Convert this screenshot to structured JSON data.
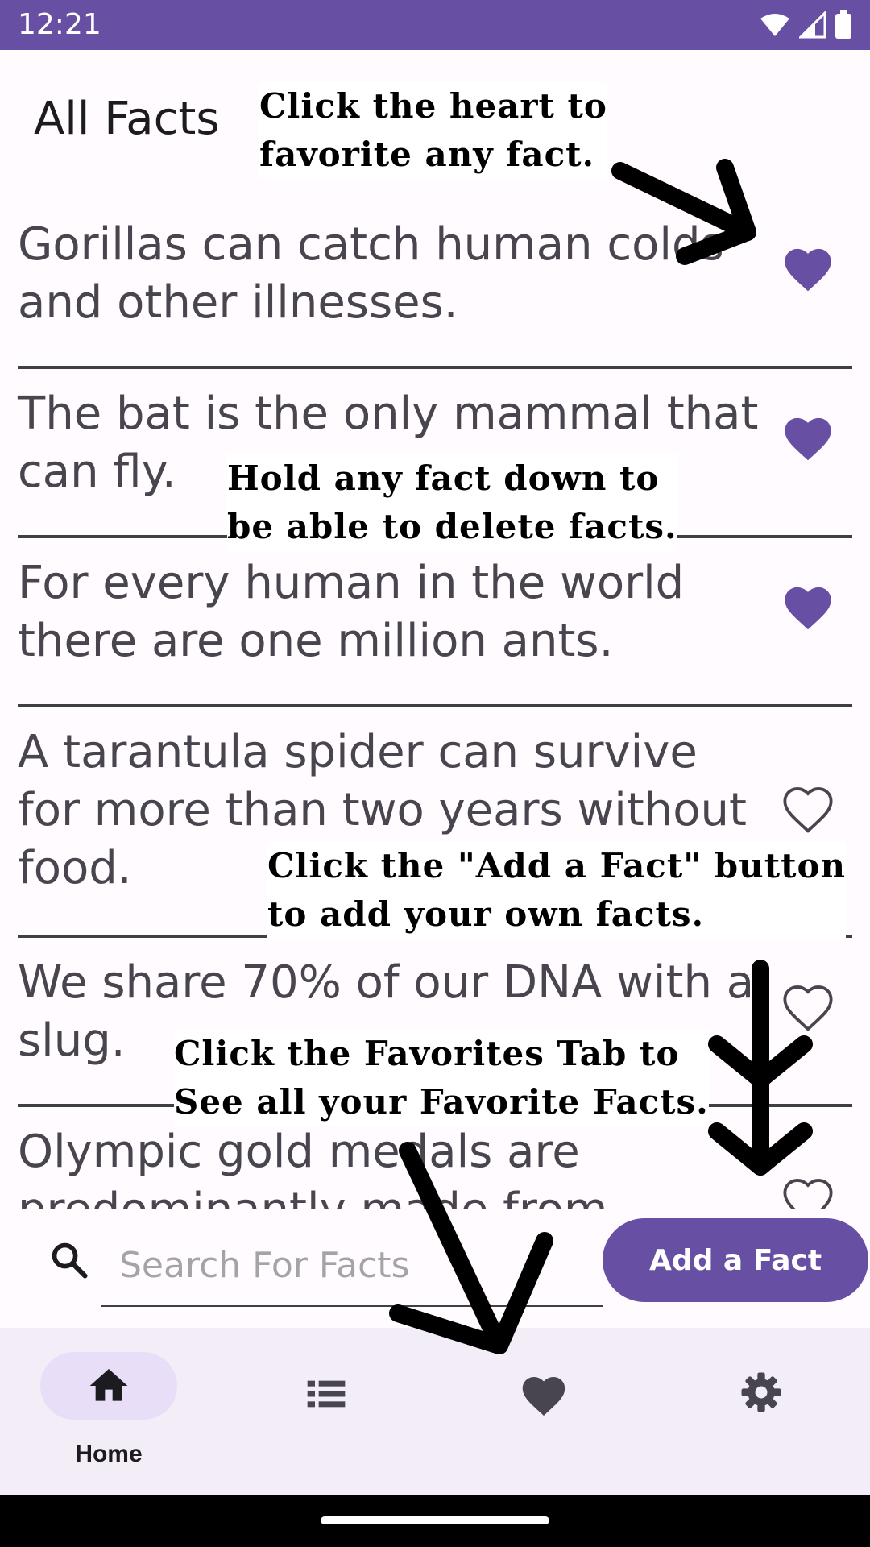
{
  "status_bar": {
    "time": "12:21"
  },
  "page": {
    "title": "All Facts"
  },
  "facts": [
    {
      "text": "Gorillas can catch human colds and other illnesses.",
      "favorited": true
    },
    {
      "text": "The bat is the only mammal that can fly.",
      "favorited": true
    },
    {
      "text": "For every human in the world there are one million ants.",
      "favorited": true
    },
    {
      "text": "A tarantula spider can survive for more than two years without food.",
      "favorited": false
    },
    {
      "text": "We share 70% of our DNA with a slug.",
      "favorited": false
    },
    {
      "text": "Olympic gold medals are predominantly made from",
      "favorited": false
    }
  ],
  "tutorial": {
    "heart_tip": "Click the heart to\nfavorite any fact.",
    "delete_tip": "Hold any fact down to\nbe able to delete facts.",
    "add_tip": "Click the \"Add a Fact\" button\nto add your own facts.",
    "favorites_tip": "Click the Favorites Tab to\nSee all your Favorite Facts."
  },
  "search": {
    "placeholder": "Search For Facts",
    "value": ""
  },
  "add_button": {
    "label": "Add a Fact"
  },
  "nav": {
    "items": [
      {
        "icon": "home-icon",
        "label": "Home",
        "selected": true
      },
      {
        "icon": "list-icon",
        "label": "",
        "selected": false
      },
      {
        "icon": "heart-icon",
        "label": "",
        "selected": false
      },
      {
        "icon": "gear-icon",
        "label": "",
        "selected": false
      }
    ]
  },
  "colors": {
    "primary": "#6750a4",
    "nav_background": "#f3edf7",
    "nav_pill": "#e8def8",
    "background": "#fffbfe"
  }
}
